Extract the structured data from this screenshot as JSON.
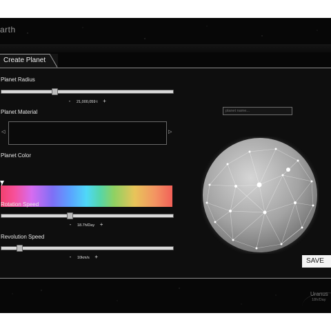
{
  "app": {
    "title": "arth"
  },
  "tab": {
    "label": "Create Planet"
  },
  "radius": {
    "label": "Planet Radius",
    "value": "21,000,059 t",
    "minus": "-",
    "plus": "+",
    "level": 0.31
  },
  "material": {
    "label": "Planet Material",
    "prev_icon": "triangle-left-outline",
    "next_icon": "triangle-right-outline"
  },
  "color": {
    "label": "Planet Color",
    "selected_position": 0.0
  },
  "rotation": {
    "label": "Rotation Speed",
    "value": "18.7h/Day",
    "minus": "-",
    "plus": "+",
    "level": 0.4
  },
  "revolution": {
    "label": "Revolution Speed",
    "value": "10km/s",
    "minus": "-",
    "plus": "+",
    "level": 0.1
  },
  "name_field": {
    "placeholder": "planet name...",
    "value": ""
  },
  "preview": {
    "icon": "wireframe-sphere"
  },
  "save": {
    "label": "SAVE"
  },
  "next_planet": {
    "name": "Uranus",
    "speed": "18h/Day"
  },
  "colors": {
    "background": "#070707",
    "panel": "#0e0e0e",
    "accent": "#ffffff"
  }
}
